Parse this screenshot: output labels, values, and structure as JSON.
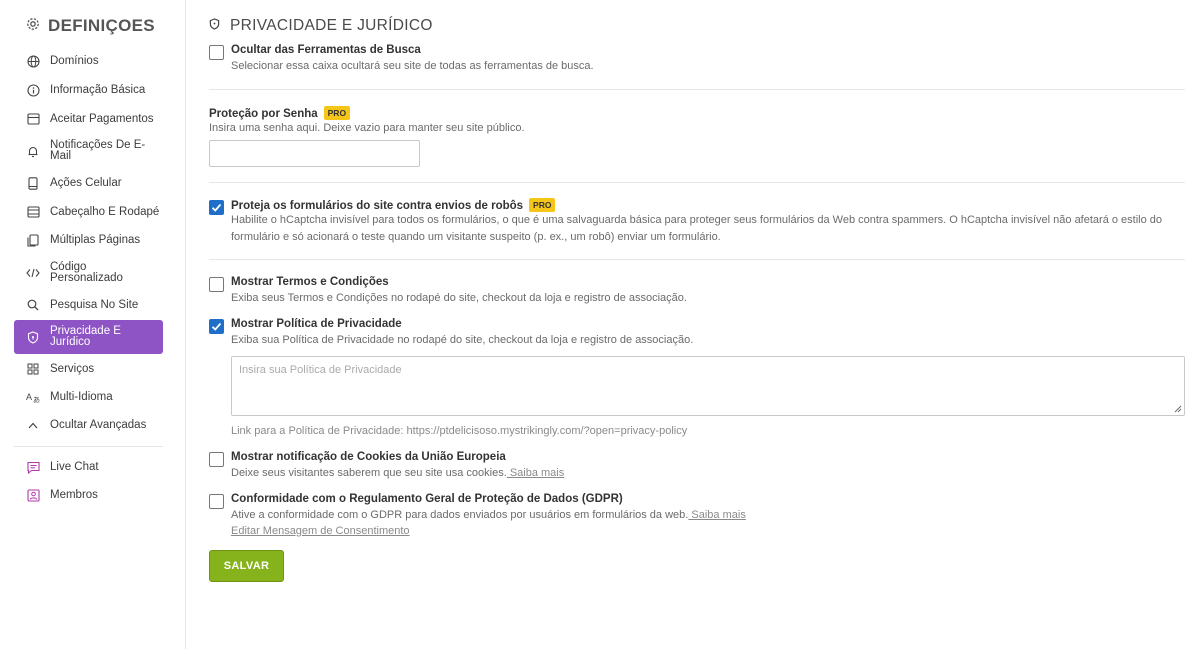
{
  "sidebar": {
    "title": "DEFINIÇOES",
    "items": [
      {
        "label": "Domínios",
        "icon": "globe-icon"
      },
      {
        "label": "Informação Básica",
        "icon": "info-icon"
      },
      {
        "label": "Aceitar Pagamentos",
        "icon": "payment-icon"
      },
      {
        "label": "Notificações De E-Mail",
        "icon": "bell-icon"
      },
      {
        "label": "Ações Celular",
        "icon": "mobile-icon"
      },
      {
        "label": "Cabeçalho E Rodapé",
        "icon": "layout-icon"
      },
      {
        "label": "Múltiplas Páginas",
        "icon": "pages-icon"
      },
      {
        "label": "Código Personalizado",
        "icon": "code-icon"
      },
      {
        "label": "Pesquisa No Site",
        "icon": "search-icon"
      },
      {
        "label": "Privacidade E Jurídico",
        "icon": "shield-icon",
        "active": true
      },
      {
        "label": "Serviços",
        "icon": "grid-icon"
      },
      {
        "label": "Multi-Idioma",
        "icon": "translate-icon"
      },
      {
        "label": "Ocultar Avançadas",
        "icon": "chevron-up-icon"
      },
      {
        "label": "Live Chat",
        "icon": "chat-icon"
      },
      {
        "label": "Membros",
        "icon": "member-icon"
      }
    ]
  },
  "main": {
    "title": "PRIVACIDADE E JURÍDICO",
    "hide_search": {
      "title": "Ocultar das Ferramentas de Busca",
      "desc": "Selecionar essa caixa ocultará seu site de todas as ferramentas de busca.",
      "checked": false
    },
    "password": {
      "title": "Proteção por Senha",
      "badge": "PRO",
      "desc": "Insira uma senha aqui. Deixe vazio para manter seu site público.",
      "value": ""
    },
    "captcha": {
      "title": "Proteja os formulários do site contra envios de robôs",
      "badge": "PRO",
      "desc": "Habilite o hCaptcha invisível para todos os formulários, o que é uma salvaguarda básica para proteger seus formulários da Web contra spammers. O hCaptcha invisível não afetará o estilo do formulário e só acionará o teste quando um visitante suspeito (p. ex., um robô) enviar um formulário.",
      "checked": true
    },
    "terms": {
      "title": "Mostrar Termos e Condições",
      "desc": "Exiba seus Termos e Condições no rodapé do site, checkout da loja e registro de associação.",
      "checked": false
    },
    "privacy_policy": {
      "title": "Mostrar Política de Privacidade",
      "desc": "Exiba sua Política de Privacidade no rodapé do site, checkout da loja e registro de associação.",
      "checked": true,
      "placeholder": "Insira sua Política de Privacidade",
      "link_text": "Link para a Política de Privacidade: https://ptdelicisoso.mystrikingly.com/?open=privacy-policy"
    },
    "cookies": {
      "title": "Mostrar notificação de Cookies da União Europeia",
      "desc": "Deixe seus visitantes saberem que seu site usa cookies.",
      "link": " Saiba mais",
      "checked": false
    },
    "gdpr": {
      "title": "Conformidade com o Regulamento Geral de Proteção de Dados (GDPR)",
      "desc": "Ative a conformidade com o GDPR para dados enviados por usuários em formulários da web.",
      "link": " Saiba mais",
      "edit_link": "Editar Mensagem de Consentimento",
      "checked": false
    },
    "save_label": "SALVAR"
  },
  "colors": {
    "accent_purple": "#8e54c6",
    "checkbox_blue": "#1f6fc8",
    "save_green": "#86b21b",
    "pro_badge": "#f5c518"
  }
}
